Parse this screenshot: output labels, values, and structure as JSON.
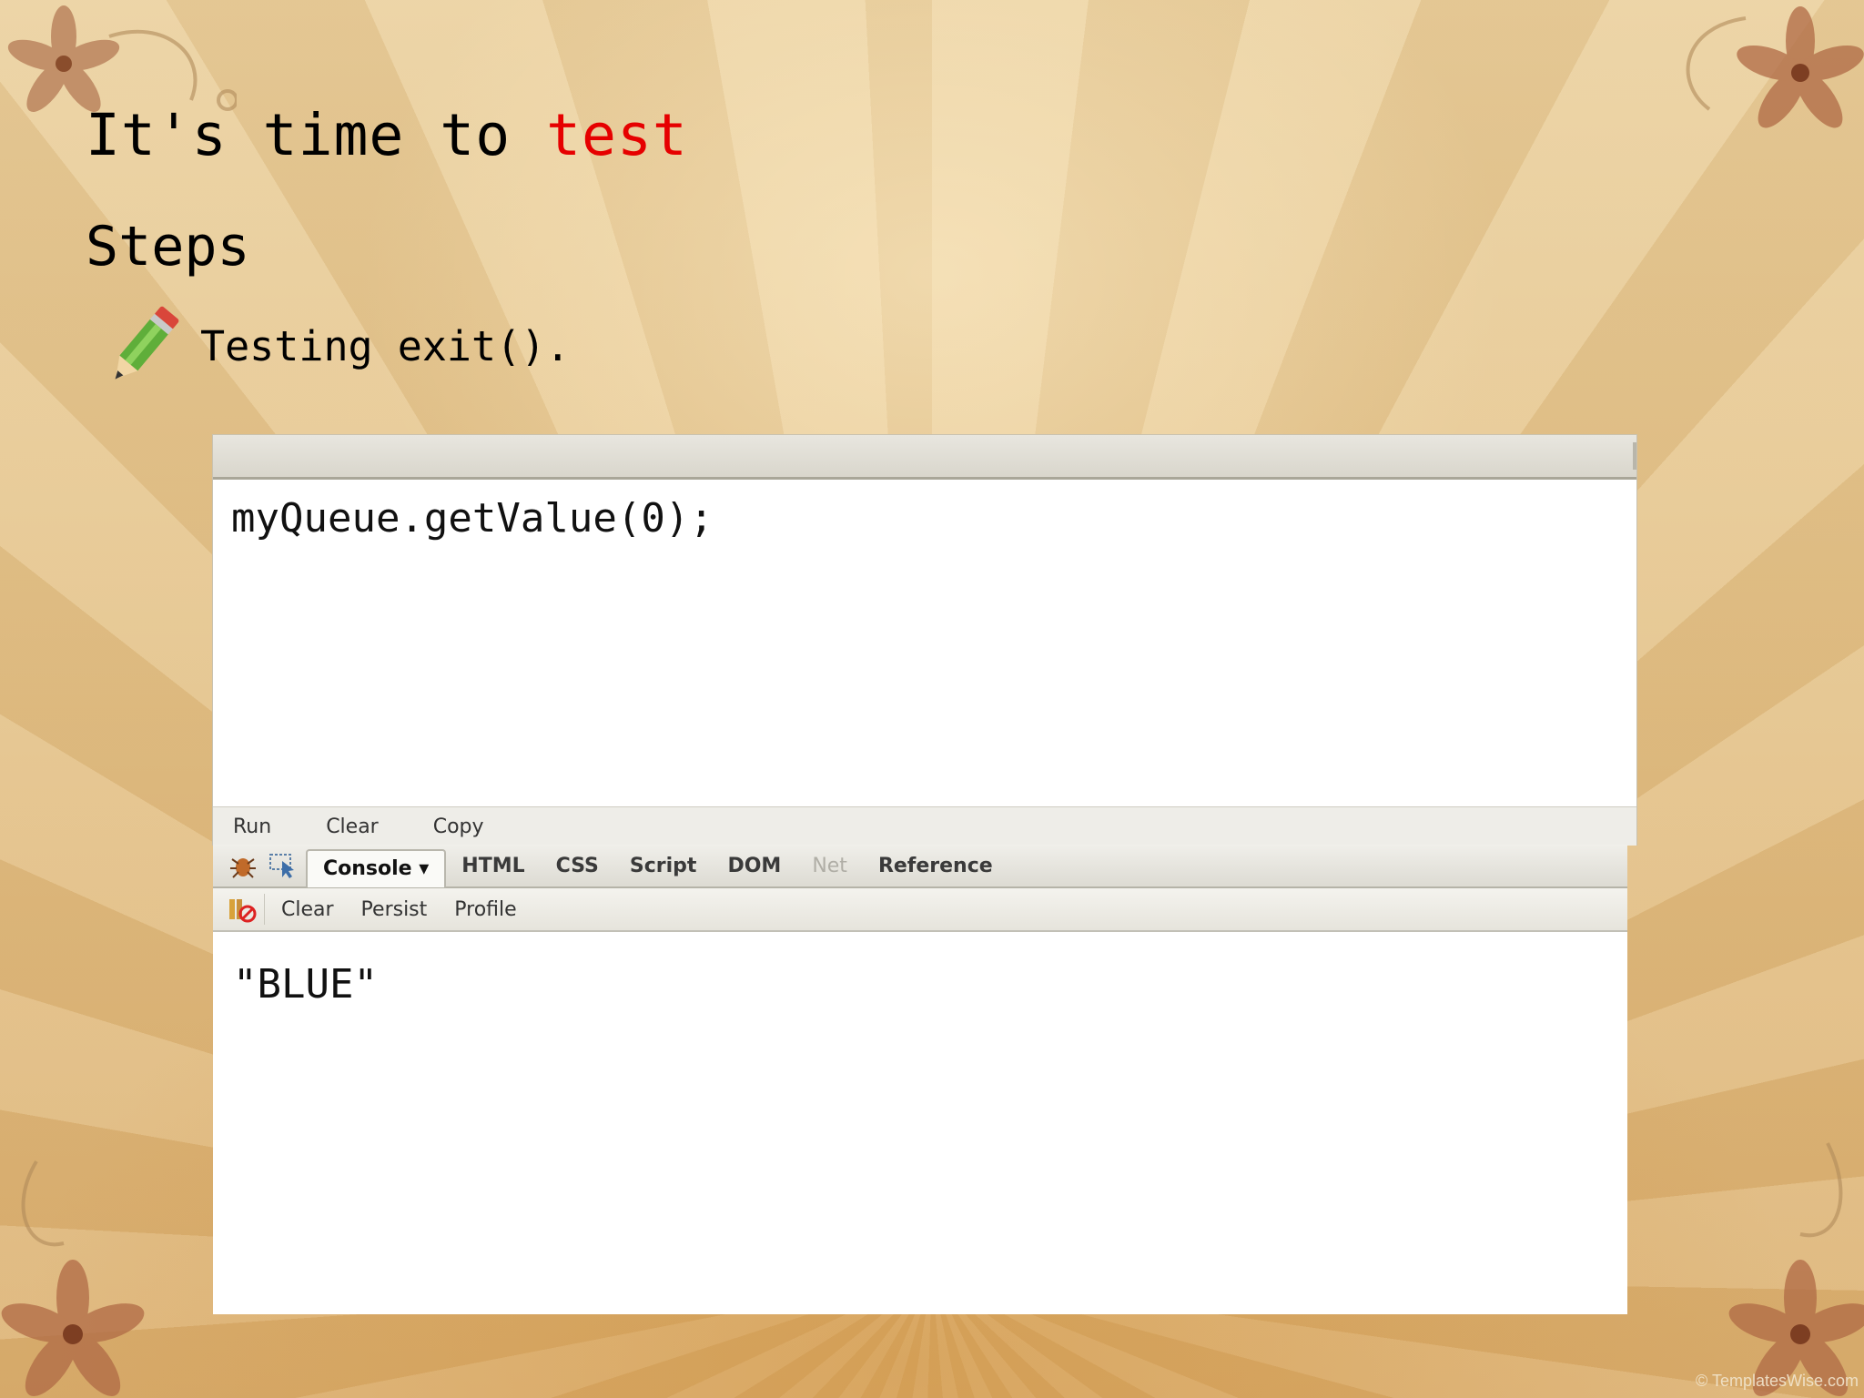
{
  "slide": {
    "title_prefix": "It's time to ",
    "title_accent": "test",
    "subtitle": "Steps",
    "bullet_text": "Testing exit().",
    "bullet_icon": "pencil-icon"
  },
  "editor": {
    "code": "myQueue.getValue(0);",
    "actions": [
      "Run",
      "Clear",
      "Copy"
    ]
  },
  "console": {
    "tabs": [
      "Console ▾",
      "HTML",
      "CSS",
      "Script",
      "DOM",
      "Net",
      "Reference"
    ],
    "active_tab": "Console ▾",
    "disabled_tab": "Net",
    "sub_actions": [
      "Clear",
      "Persist",
      "Profile"
    ],
    "output": "\"BLUE\""
  },
  "watermark": "© TemplatesWise.com",
  "colors": {
    "accent": "#e60000"
  }
}
